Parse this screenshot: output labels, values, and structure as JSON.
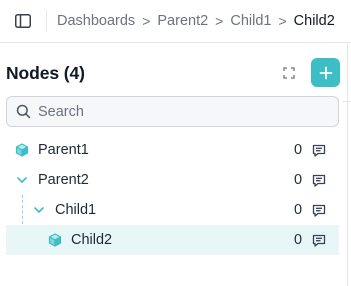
{
  "breadcrumb": {
    "items": [
      "Dashboards",
      "Parent2",
      "Child1",
      "Child2"
    ],
    "separator": ">"
  },
  "panel": {
    "title": "Nodes (4)"
  },
  "search": {
    "placeholder": "Search",
    "value": ""
  },
  "tree": {
    "nodes": [
      {
        "label": "Parent1",
        "count": "0",
        "icon": "cube-icon",
        "depth": 0,
        "expanded": false,
        "selected": false
      },
      {
        "label": "Parent2",
        "count": "0",
        "icon": "chevron-down-icon",
        "depth": 0,
        "expanded": true,
        "selected": false
      },
      {
        "label": "Child1",
        "count": "0",
        "icon": "chevron-down-icon",
        "depth": 1,
        "expanded": true,
        "selected": false
      },
      {
        "label": "Child2",
        "count": "0",
        "icon": "cube-icon",
        "depth": 2,
        "expanded": false,
        "selected": true
      }
    ]
  },
  "colors": {
    "accent": "#3dbdc5",
    "selected_row": "#e9f6f7",
    "guide_line": "#8fd3d8"
  }
}
